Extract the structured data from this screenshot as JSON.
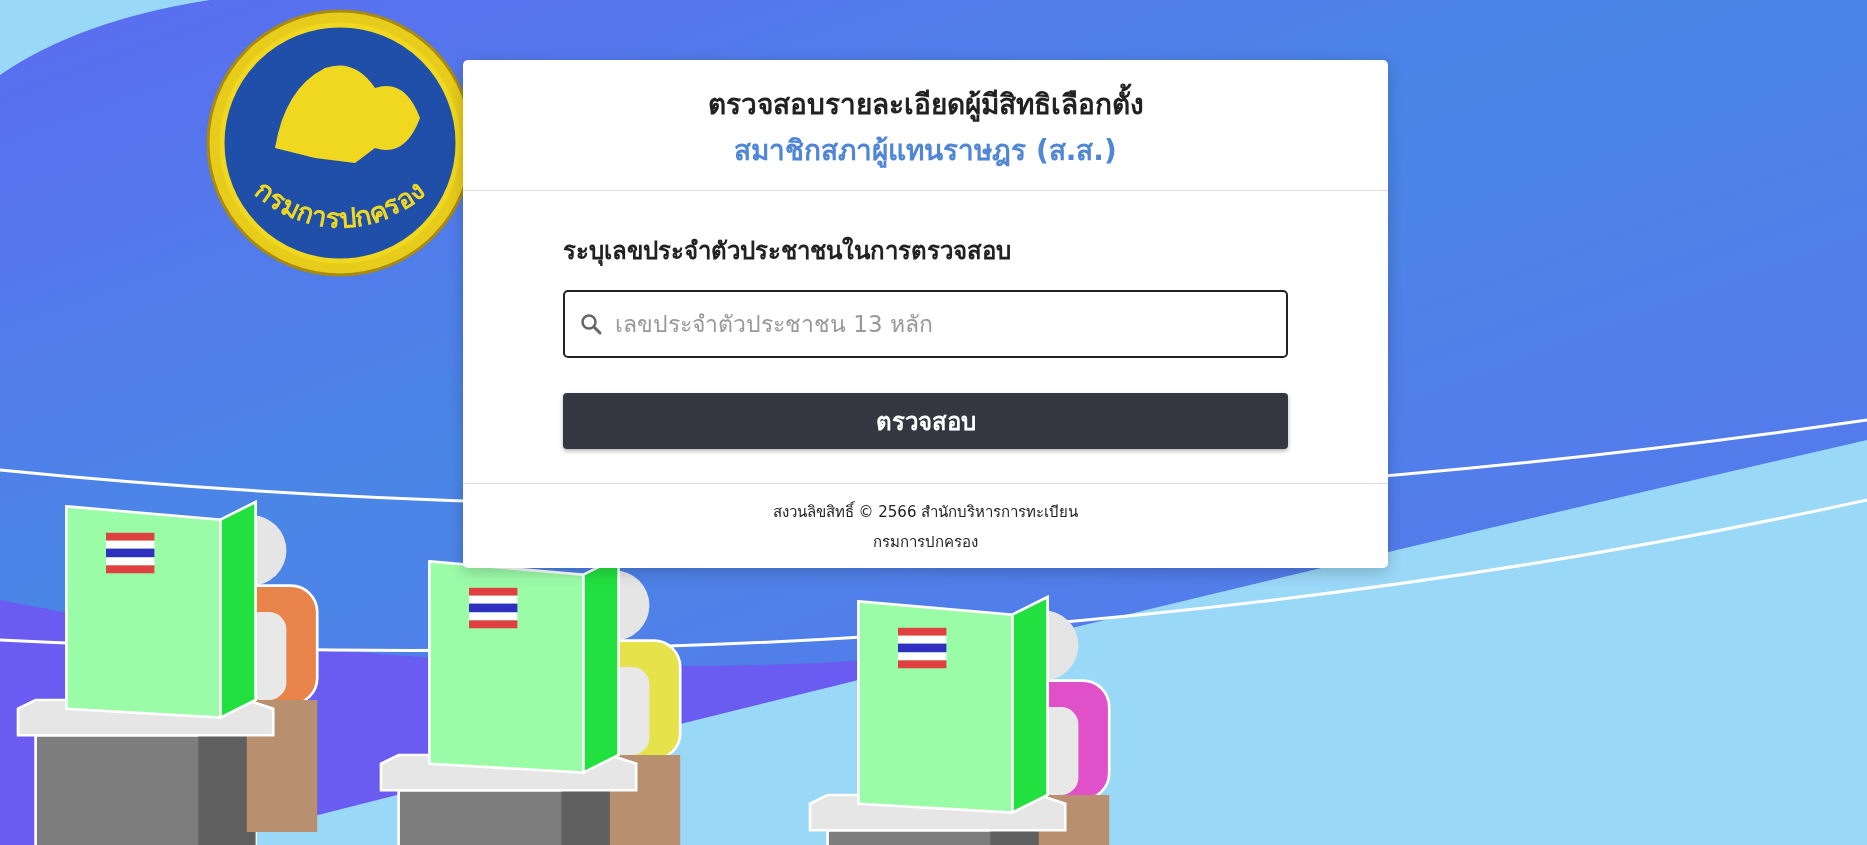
{
  "logo": {
    "text": "กรมการปกครอง"
  },
  "card": {
    "title": "ตรวจสอบรายละเอียดผู้มีสิทธิเลือกตั้ง",
    "subtitle": "สมาชิกสภาผู้แทนราษฎร (ส.ส.)",
    "field_label": "ระบุเลขประจำตัวประชาชนในการตรวจสอบ",
    "search": {
      "placeholder": "เลขประจำตัวประชาชน 13 หลัก"
    },
    "button": "ตรวจสอบ",
    "footer": [
      "สงวนลิขสิทธิ์ © 2566 สำนักบริหารการทะเบียน",
      "กรมการปกครอง"
    ]
  }
}
